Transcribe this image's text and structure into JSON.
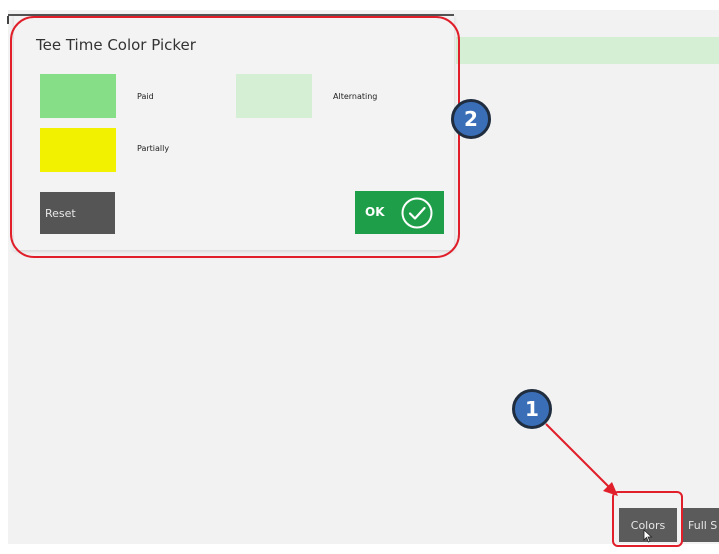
{
  "dialog": {
    "title": "Tee Time Color Picker",
    "swatches": [
      {
        "label": "Paid",
        "color": "#86df86"
      },
      {
        "label": "Alternating",
        "color": "#d4efd4"
      },
      {
        "label": "Partially",
        "color": "#f2f200"
      }
    ],
    "reset_label": "Reset",
    "ok_label": "OK",
    "ok_icon": "check-circle-icon"
  },
  "background": {
    "strip_color": "#d4efd4"
  },
  "callouts": [
    {
      "number": "2",
      "color": "#3a6fb8"
    },
    {
      "number": "1",
      "color": "#3a6fb8"
    }
  ],
  "toolbar": {
    "colors_label": "Colors",
    "fullscreen_label": "Full S"
  }
}
